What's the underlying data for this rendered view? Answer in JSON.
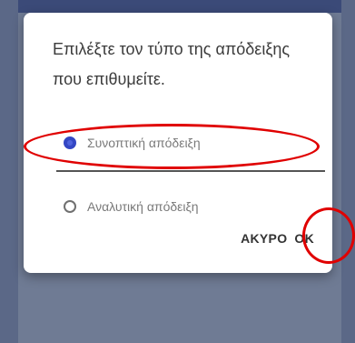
{
  "dialog": {
    "message": "Επιλέξτε τον τύπο της απόδειξης που επιθυμείτε.",
    "options": [
      {
        "label": "Συνοπτική απόδειξη",
        "selected": true
      },
      {
        "label": "Αναλυτική απόδειξη",
        "selected": false
      }
    ],
    "buttons": {
      "cancel": "ΑΚΥΡΟ",
      "ok": "OK"
    }
  },
  "colors": {
    "accent": "#3447c4",
    "annotation": "#e00000",
    "backdrop": "#6f7b94"
  }
}
